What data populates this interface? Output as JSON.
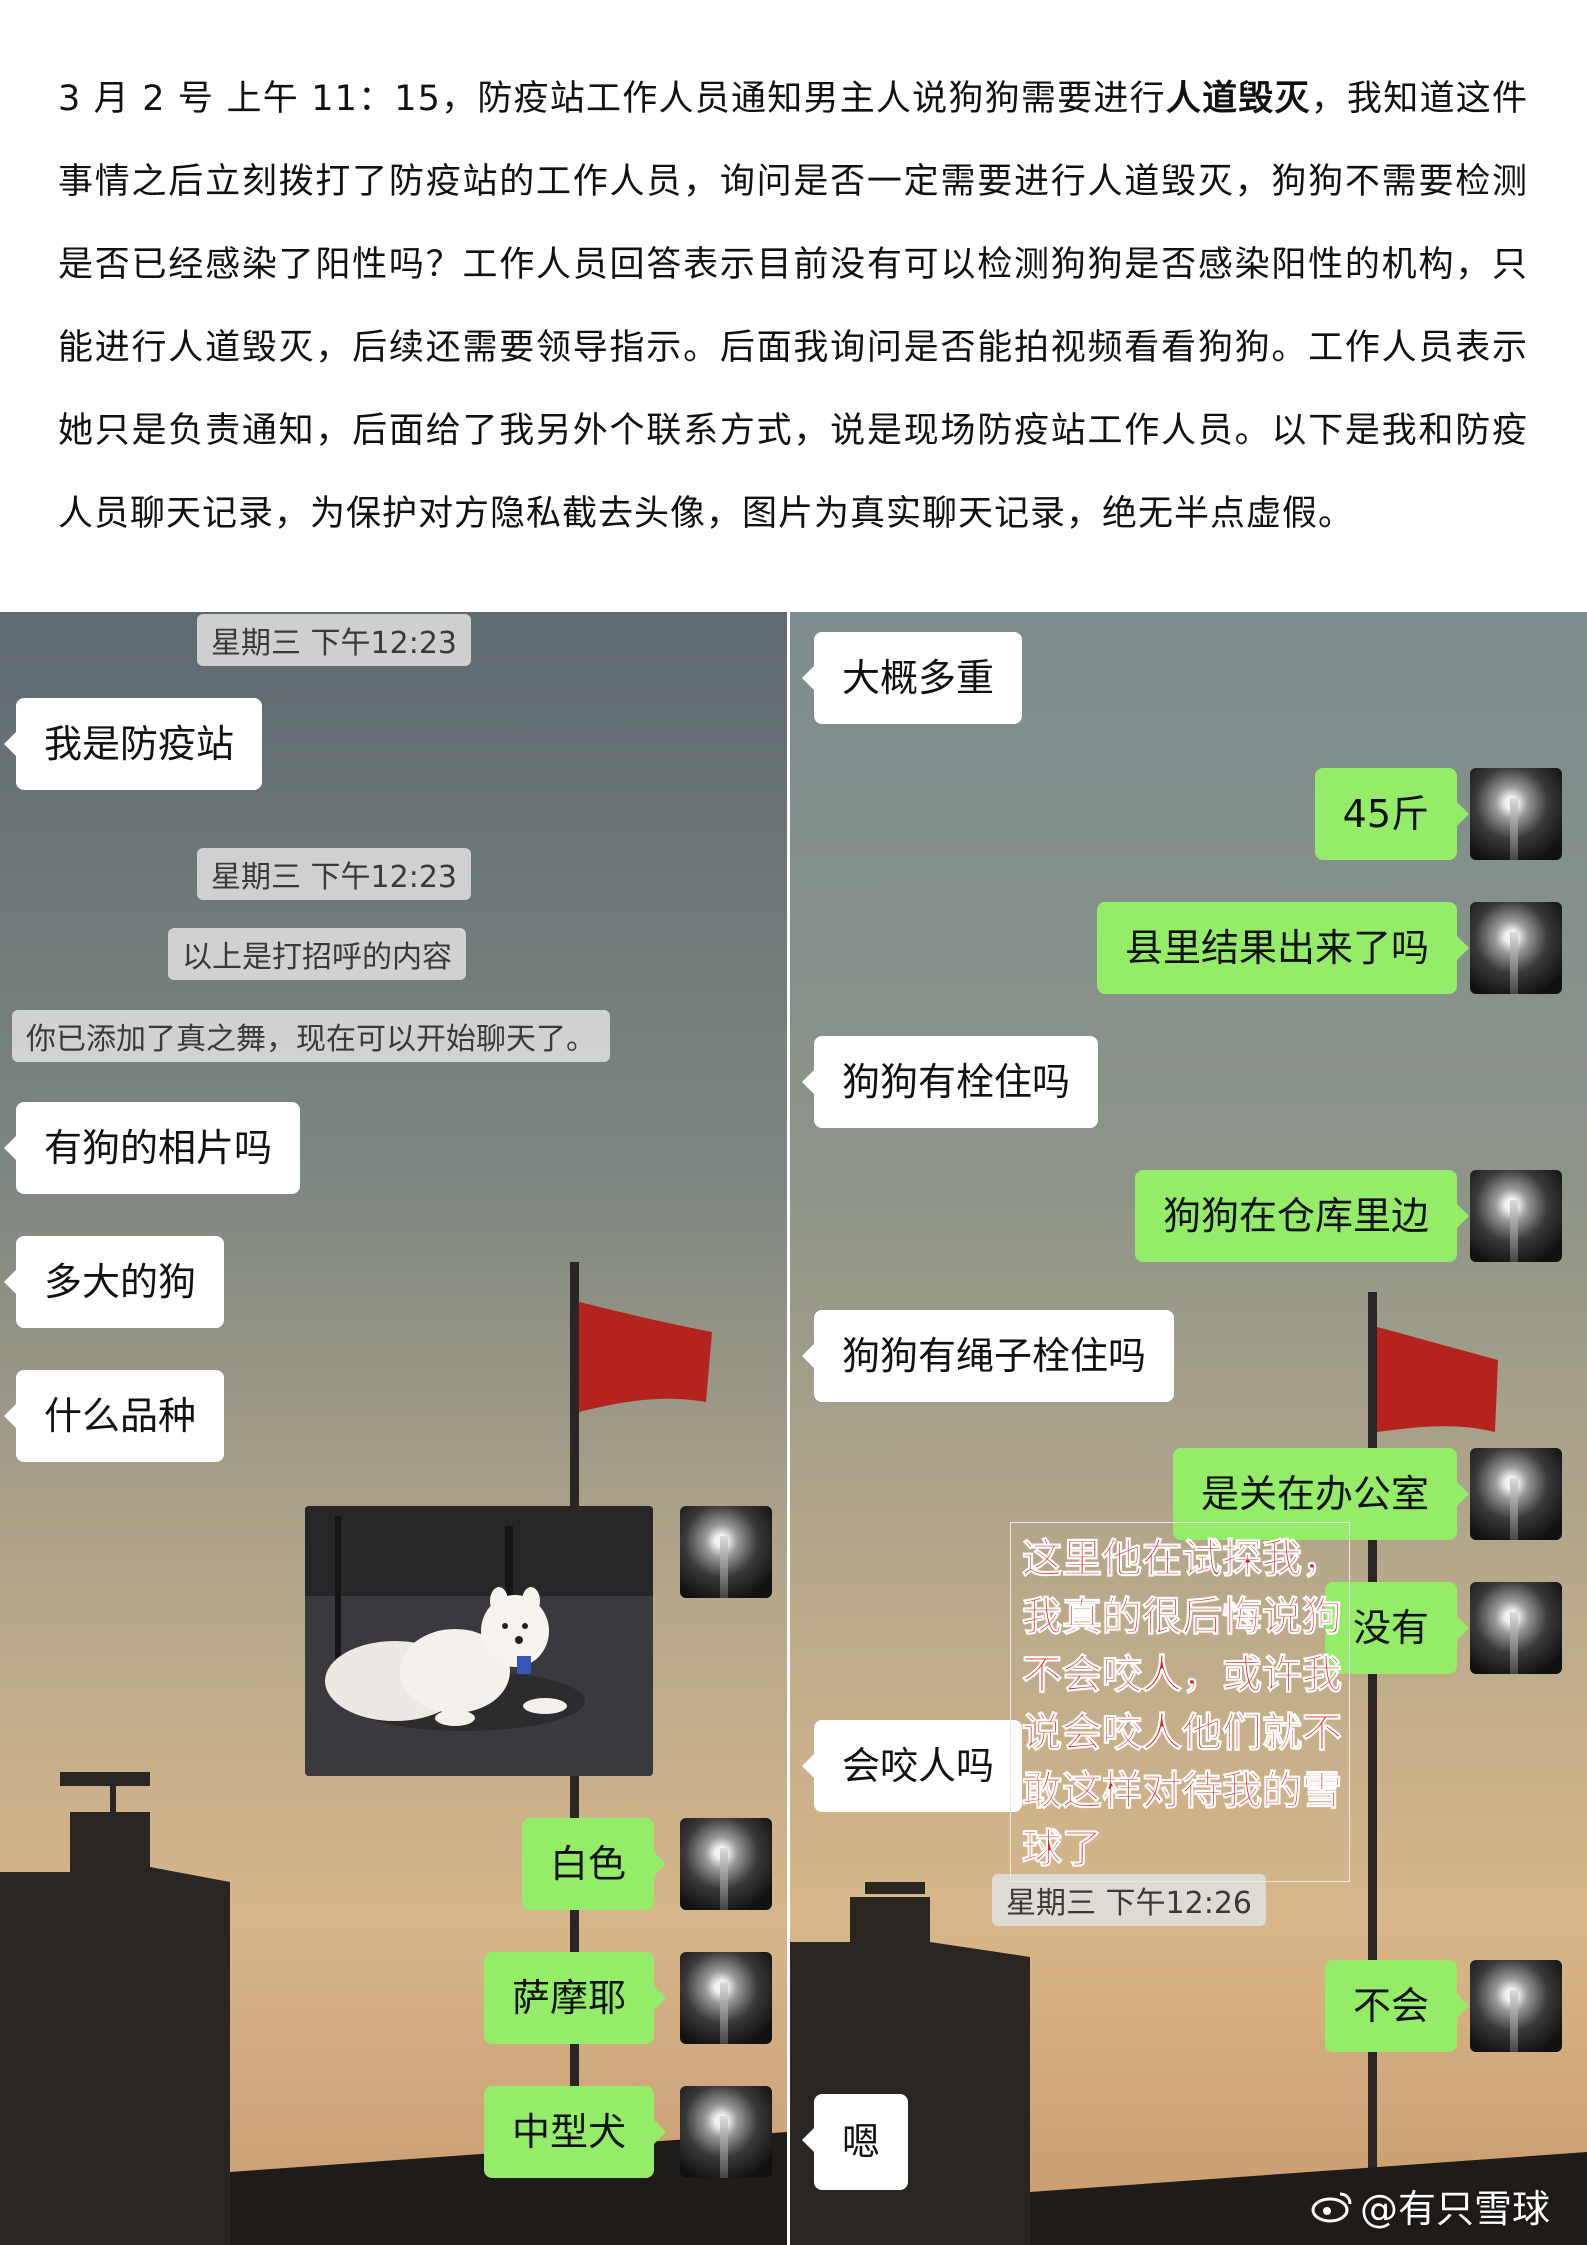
{
  "intro": {
    "part1": "3 月 2 号 上午 11：15，防疫站工作人员通知男主人说狗狗需要进行",
    "bold": "人道毁灭",
    "part2": "，我知道这件事情之后立刻拨打了防疫站的工作人员，询问是否一定需要进行人道毁灭，狗狗不需要检测是否已经感染了阳性吗？工作人员回答表示目前没有可以检测狗狗是否感染阳性的机构，只能进行人道毁灭，后续还需要领导指示。后面我询问是否能拍视频看看狗狗。工作人员表示她只是负责通知，后面给了我另外个联系方式，说是现场防疫站工作人员。以下是我和防疫人员聊天记录，为保护对方隐私截去头像，图片为真实聊天记录，绝无半点虚假。"
  },
  "left_chat": {
    "time1": "星期三 下午12:23",
    "msg1": "我是防疫站",
    "time2": "星期三 下午12:23",
    "notice1": "以上是打招呼的内容",
    "notice2": "你已添加了真之舞，现在可以开始聊天了。",
    "msg2": "有狗的相片吗",
    "msg3": "多大的狗",
    "msg4": "什么品种",
    "reply1": "白色",
    "reply2": "萨摩耶",
    "reply3": "中型犬"
  },
  "right_chat": {
    "msg1": "大概多重",
    "reply1": "45斤",
    "reply2": "县里结果出来了吗",
    "msg2": "狗狗有栓住吗",
    "reply3": "狗狗在仓库里边",
    "msg3": "狗狗有绳子栓住吗",
    "reply4": "是关在办公室",
    "reply5": "没有",
    "msg4": "会咬人吗",
    "time1": "星期三 下午12:26",
    "reply6": "不会",
    "msg5": "嗯"
  },
  "annotation": "这里他在试探我，我真的很后悔说狗不会咬人，或许我说会咬人他们就不敢这样对待我的雪球了",
  "watermark": "@有只雪球"
}
